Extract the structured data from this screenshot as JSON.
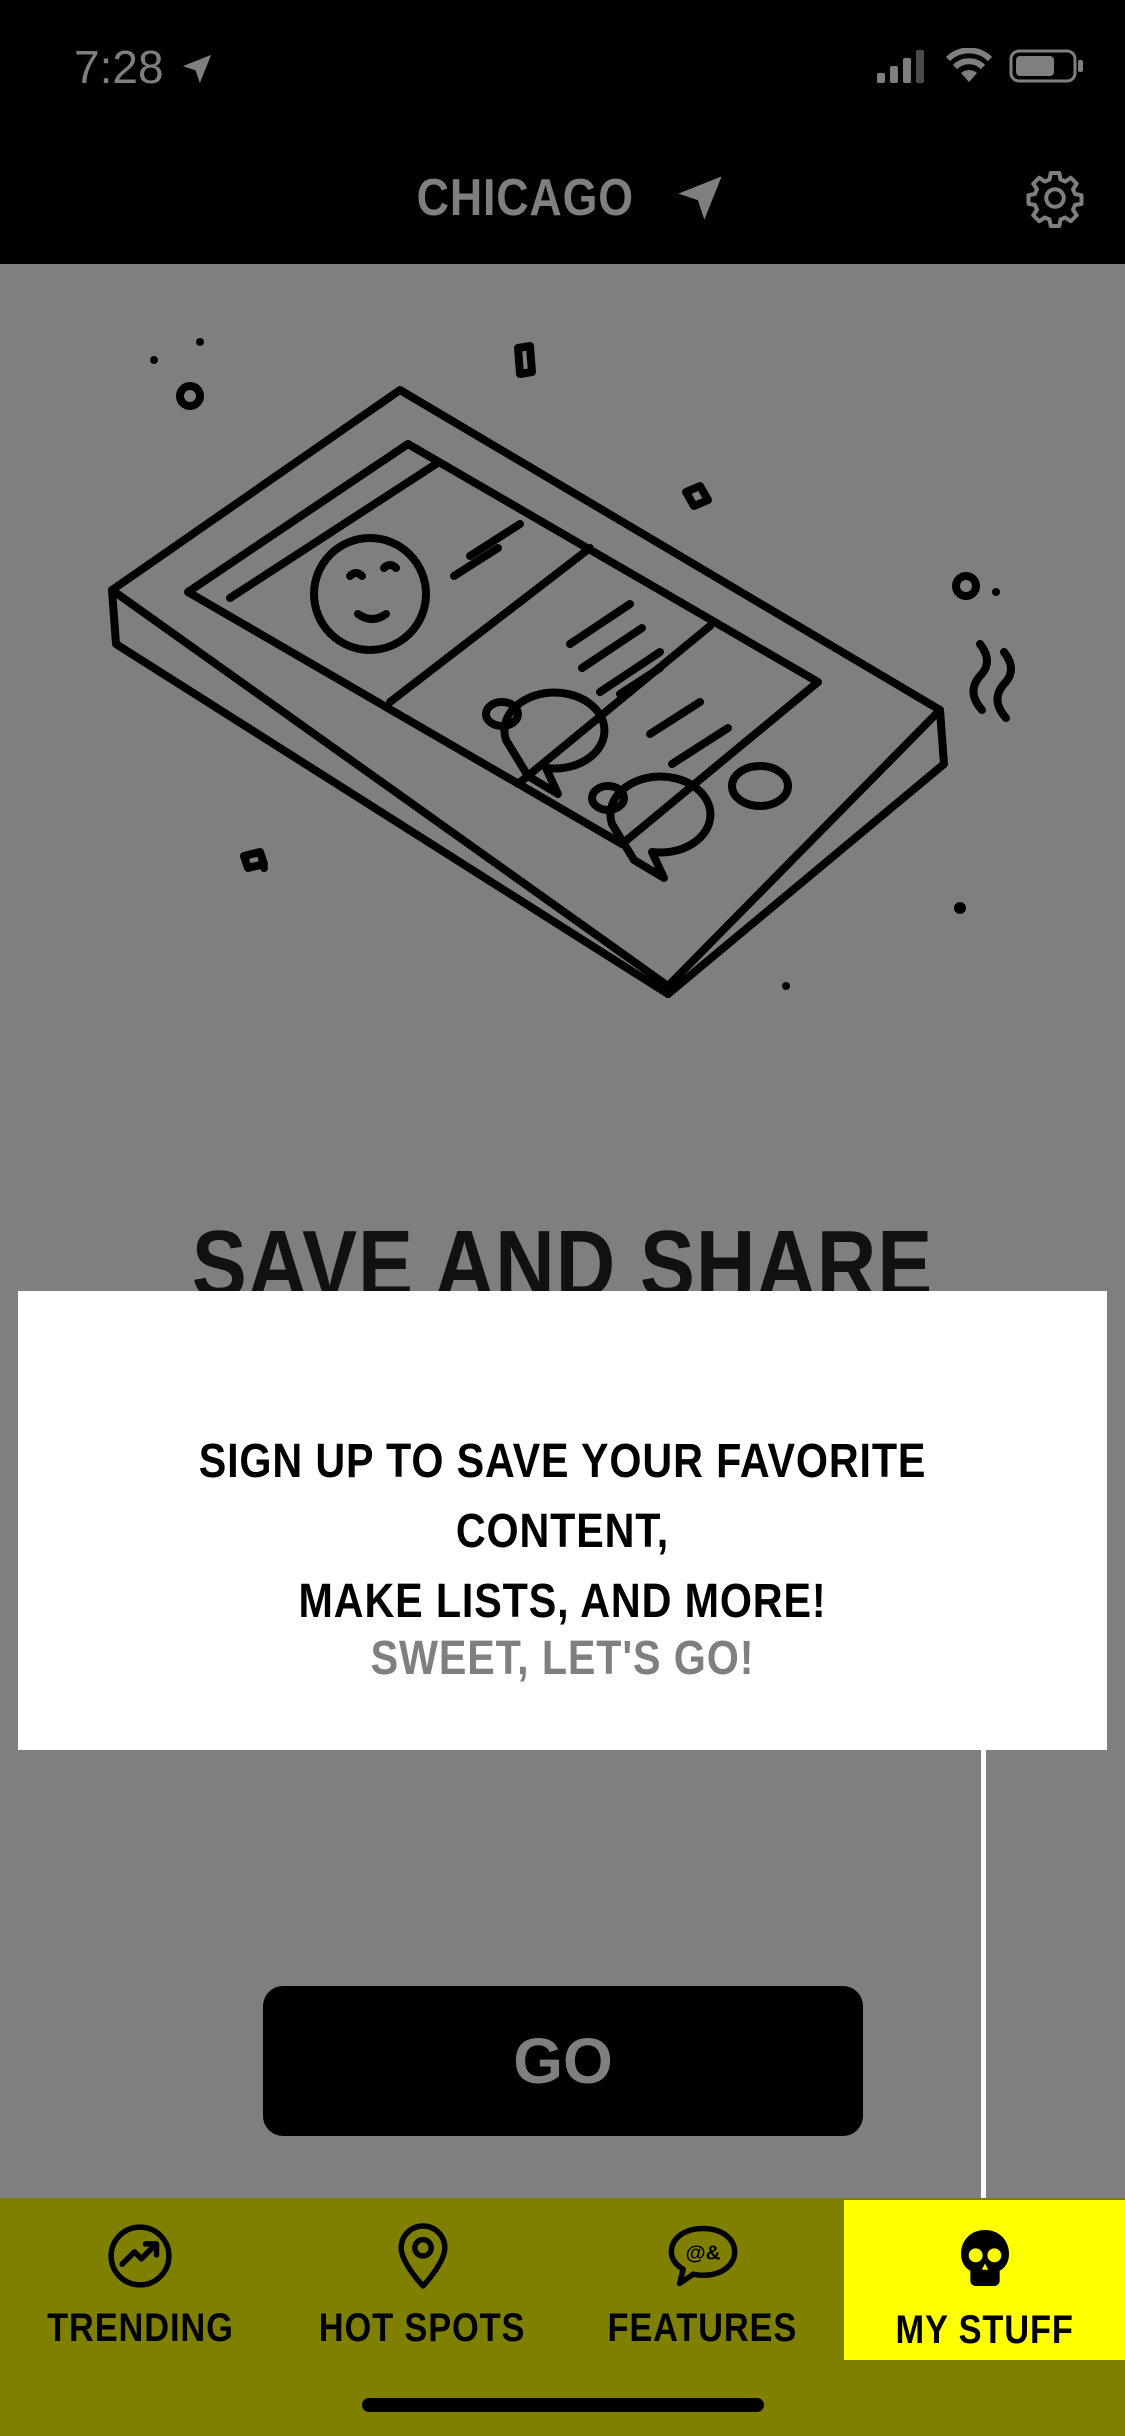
{
  "status_bar": {
    "time": "7:28"
  },
  "header": {
    "city": "CHICAGO"
  },
  "feature": {
    "title": "SAVE AND SHARE"
  },
  "callout": {
    "line1": "SIGN UP TO SAVE YOUR FAVORITE CONTENT,",
    "line2": "MAKE LISTS, AND MORE!",
    "action": "SWEET, LET'S GO!"
  },
  "go_button": {
    "label": "GO"
  },
  "tabs": [
    {
      "label": "TRENDING",
      "icon": "trending-icon",
      "selected": false
    },
    {
      "label": "HOT SPOTS",
      "icon": "location-pin-icon",
      "selected": false
    },
    {
      "label": "FEATURES",
      "icon": "speech-bubble-icon",
      "selected": false
    },
    {
      "label": "MY STUFF",
      "icon": "skull-icon",
      "selected": true
    }
  ],
  "colors": {
    "overlay_gray": "#7f7f7f",
    "tab_bar": "#808000",
    "tab_active": "#ffff00",
    "header": "#000000"
  }
}
